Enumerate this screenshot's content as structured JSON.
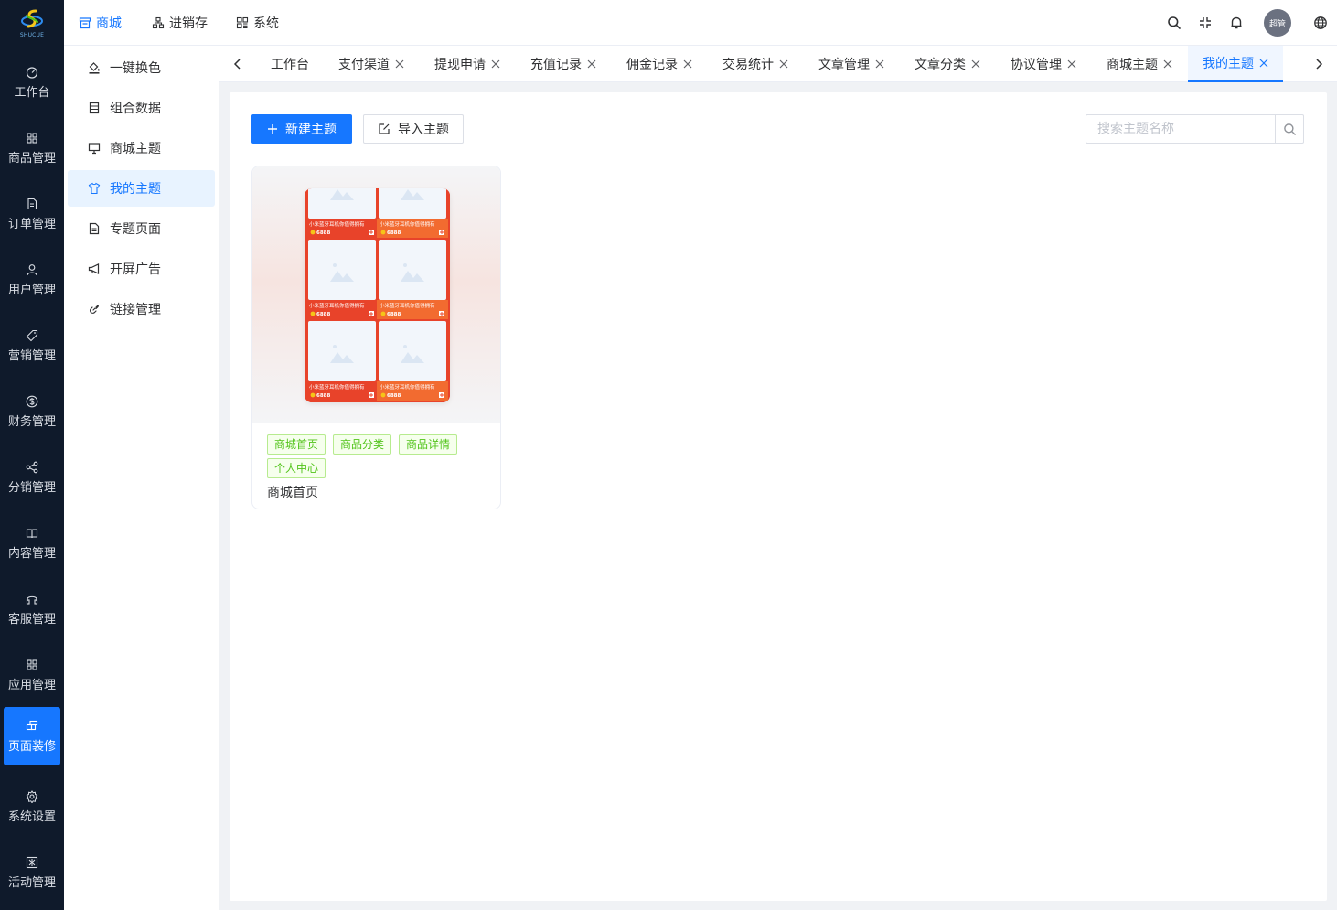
{
  "logo": {
    "text": "SHUCUE"
  },
  "sidebar": {
    "items": [
      {
        "label": "工作台",
        "icon": "dashboard-icon"
      },
      {
        "label": "商品管理",
        "icon": "grid-icon"
      },
      {
        "label": "订单管理",
        "icon": "document-icon"
      },
      {
        "label": "用户管理",
        "icon": "user-icon"
      },
      {
        "label": "营销管理",
        "icon": "tag-icon"
      },
      {
        "label": "财务管理",
        "icon": "dollar-icon"
      },
      {
        "label": "分销管理",
        "icon": "share-icon"
      },
      {
        "label": "内容管理",
        "icon": "book-icon"
      },
      {
        "label": "客服管理",
        "icon": "headset-icon"
      },
      {
        "label": "应用管理",
        "icon": "apps-icon"
      },
      {
        "label": "页面装修",
        "icon": "layout-icon",
        "active": true
      },
      {
        "label": "系统设置",
        "icon": "gear-icon"
      },
      {
        "label": "活动管理",
        "icon": "activity-icon"
      }
    ]
  },
  "header": {
    "nav": [
      {
        "label": "商城",
        "icon": "shop-icon",
        "active": true
      },
      {
        "label": "进销存",
        "icon": "inventory-icon"
      },
      {
        "label": "系统",
        "icon": "system-icon"
      }
    ],
    "avatar_text": "超管"
  },
  "submenu": {
    "items": [
      {
        "label": "一键换色",
        "icon": "paint-bucket-icon"
      },
      {
        "label": "组合数据",
        "icon": "stack-icon"
      },
      {
        "label": "商城主题",
        "icon": "monitor-icon"
      },
      {
        "label": "我的主题",
        "icon": "shirt-icon",
        "active": true
      },
      {
        "label": "专题页面",
        "icon": "page-icon"
      },
      {
        "label": "开屏广告",
        "icon": "megaphone-icon"
      },
      {
        "label": "链接管理",
        "icon": "link-icon"
      }
    ]
  },
  "tabs": [
    {
      "label": "工作台",
      "closable": false
    },
    {
      "label": "支付渠道",
      "closable": true
    },
    {
      "label": "提现申请",
      "closable": true
    },
    {
      "label": "充值记录",
      "closable": true
    },
    {
      "label": "佣金记录",
      "closable": true
    },
    {
      "label": "交易统计",
      "closable": true
    },
    {
      "label": "文章管理",
      "closable": true
    },
    {
      "label": "文章分类",
      "closable": true
    },
    {
      "label": "协议管理",
      "closable": true
    },
    {
      "label": "商城主题",
      "closable": true
    },
    {
      "label": "我的主题",
      "closable": true,
      "active": true
    }
  ],
  "toolbar": {
    "new_label": "新建主题",
    "import_label": "导入主题",
    "search_placeholder": "搜索主题名称"
  },
  "themes": [
    {
      "title": "商城首页",
      "tags": [
        "商城首页",
        "商品分类",
        "商品详情",
        "个人中心"
      ],
      "preview_product_name": "小米蓝牙耳机你值得拥有",
      "preview_price": "6888"
    }
  ],
  "colors": {
    "primary": "#1677ff",
    "sidebar_bg": "#0f1a2b",
    "tag_green": "#52c41a",
    "preview_red": "#e8432a"
  }
}
